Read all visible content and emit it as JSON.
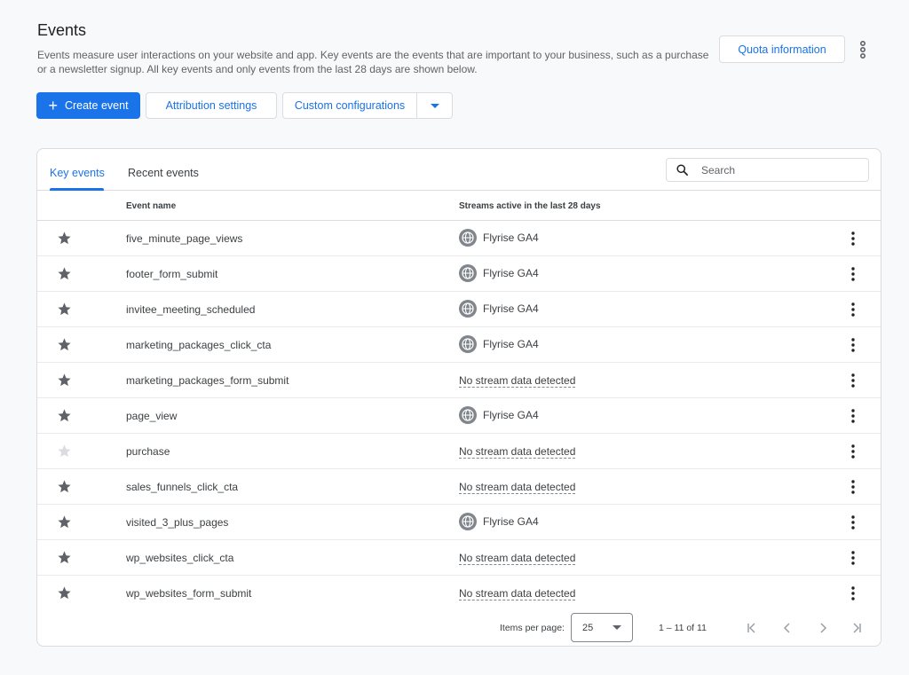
{
  "header": {
    "title": "Events",
    "description": "Events measure user interactions on your website and app. Key events are the events that are important to your business, such as a purchase or a newsletter signup. All key events and only events from the last 28 days are shown below.",
    "quota_label": "Quota information",
    "more_icon": "more-vert-icon"
  },
  "toolbar": {
    "create_label": "Create event",
    "attribution_label": "Attribution settings",
    "custom_label": "Custom configurations"
  },
  "tabs": [
    {
      "label": "Key events",
      "active": true
    },
    {
      "label": "Recent events",
      "active": false
    }
  ],
  "search": {
    "placeholder": "Search"
  },
  "table": {
    "col_event_name": "Event name",
    "col_streams": "Streams active in the last 28 days",
    "rows": [
      {
        "name": "five_minute_page_views",
        "stream": "Flyrise GA4",
        "has_stream": true,
        "starred": true
      },
      {
        "name": "footer_form_submit",
        "stream": "Flyrise GA4",
        "has_stream": true,
        "starred": true
      },
      {
        "name": "invitee_meeting_scheduled",
        "stream": "Flyrise GA4",
        "has_stream": true,
        "starred": true
      },
      {
        "name": "marketing_packages_click_cta",
        "stream": "Flyrise GA4",
        "has_stream": true,
        "starred": true
      },
      {
        "name": "marketing_packages_form_submit",
        "stream": "No stream data detected",
        "has_stream": false,
        "starred": true
      },
      {
        "name": "page_view",
        "stream": "Flyrise GA4",
        "has_stream": true,
        "starred": true
      },
      {
        "name": "purchase",
        "stream": "No stream data detected",
        "has_stream": false,
        "starred": false
      },
      {
        "name": "sales_funnels_click_cta",
        "stream": "No stream data detected",
        "has_stream": false,
        "starred": true
      },
      {
        "name": "visited_3_plus_pages",
        "stream": "Flyrise GA4",
        "has_stream": true,
        "starred": true
      },
      {
        "name": "wp_websites_click_cta",
        "stream": "No stream data detected",
        "has_stream": false,
        "starred": true
      },
      {
        "name": "wp_websites_form_submit",
        "stream": "No stream data detected",
        "has_stream": false,
        "starred": true
      }
    ]
  },
  "pagination": {
    "items_per_page_label": "Items per page:",
    "items_per_page": "25",
    "range": "1 – 11 of 11"
  },
  "colors": {
    "accent": "#1a73e8",
    "star_active": "#5f6368",
    "star_inactive": "#dadce0"
  }
}
